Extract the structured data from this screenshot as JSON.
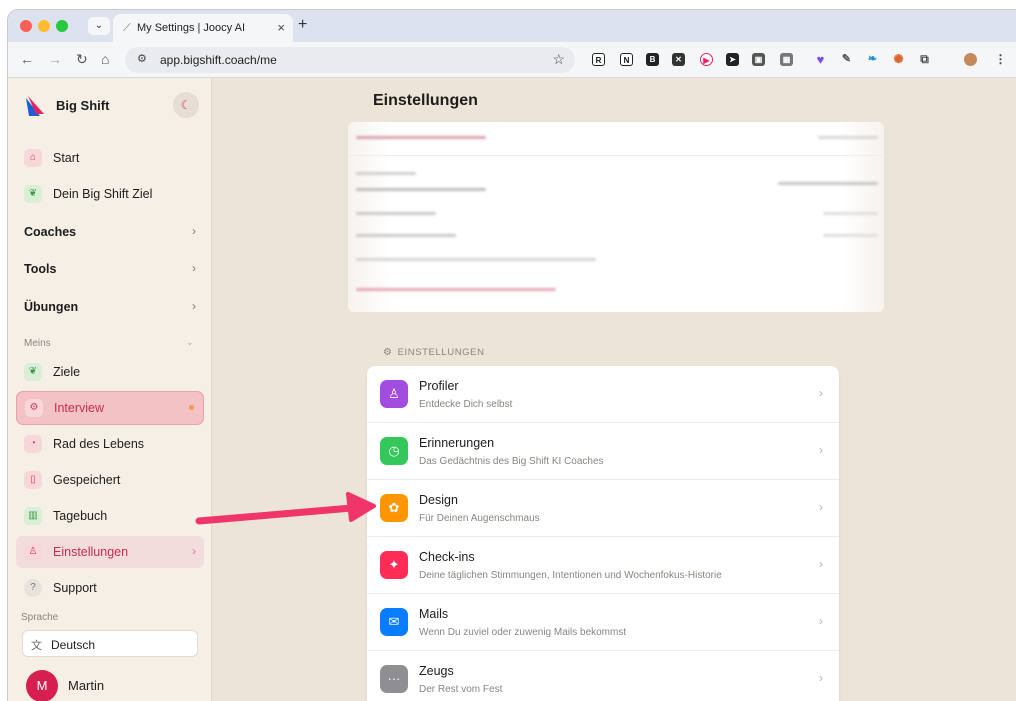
{
  "browser": {
    "tab_title": "My Settings | Joocy AI",
    "tab_close": "×",
    "new_tab": "+",
    "url": "app.bigshift.coach/me"
  },
  "sidebar": {
    "brand": "Big Shift",
    "items_top": [
      {
        "label": "Start",
        "icon": "home-icon"
      },
      {
        "label": "Dein Big Shift Ziel",
        "icon": "leaf-icon"
      }
    ],
    "sections": [
      {
        "label": "Coaches"
      },
      {
        "label": "Tools"
      },
      {
        "label": "Übungen"
      }
    ],
    "meins_label": "Meins",
    "items_meins": [
      {
        "label": "Ziele",
        "icon": "leaf-icon"
      },
      {
        "label": "Interview",
        "icon": "gear-icon"
      },
      {
        "label": "Rad des Lebens",
        "icon": "pie-chart-icon"
      },
      {
        "label": "Gespeichert",
        "icon": "bookmark-icon"
      },
      {
        "label": "Tagebuch",
        "icon": "book-icon"
      },
      {
        "label": "Einstellungen",
        "icon": "user-icon"
      },
      {
        "label": "Support",
        "icon": "help-icon"
      }
    ],
    "sprache_label": "Sprache",
    "language": "Deutsch",
    "user": {
      "initial": "M",
      "name": "Martin"
    }
  },
  "main": {
    "page_title": "Einstellungen",
    "section_header": "EINSTELLUNGEN",
    "settings": [
      {
        "title": "Profiler",
        "subtitle": "Entdecke Dich selbst",
        "color": "#a24de0",
        "icon": "person-icon"
      },
      {
        "title": "Erinnerungen",
        "subtitle": "Das Gedächtnis des Big Shift KI Coaches",
        "color": "#34c759",
        "icon": "clock-icon"
      },
      {
        "title": "Design",
        "subtitle": "Für Deinen Augenschmaus",
        "color": "#ff9500",
        "icon": "palette-icon"
      },
      {
        "title": "Check-ins",
        "subtitle": "Deine täglichen Stimmungen, Intentionen und Wochenfokus-Historie",
        "color": "#ff2d55",
        "icon": "sparkle-icon"
      },
      {
        "title": "Mails",
        "subtitle": "Wenn Du zuviel oder zuwenig Mails bekommst",
        "color": "#0a7cff",
        "icon": "mail-icon"
      },
      {
        "title": "Zeugs",
        "subtitle": "Der Rest vom Fest",
        "color": "#8e8e93",
        "icon": "more-icon"
      }
    ]
  },
  "colors": {
    "accent": "#c62d52",
    "arrow": "#f0356b",
    "page_bg": "#ede4d8"
  }
}
